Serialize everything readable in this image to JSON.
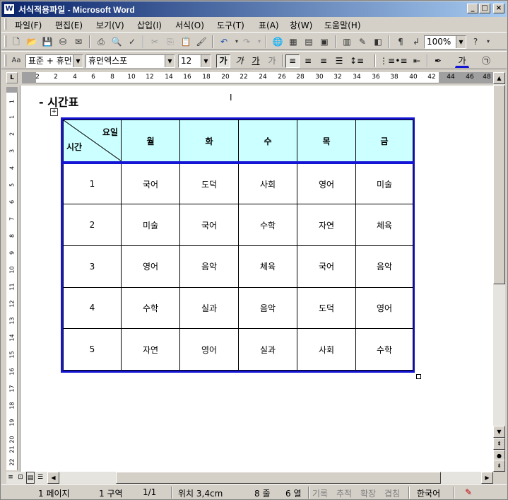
{
  "window": {
    "title": "서식적용파일 - Microsoft Word"
  },
  "menu": [
    "파일(F)",
    "편집(E)",
    "보기(V)",
    "삽입(I)",
    "서식(O)",
    "도구(T)",
    "표(A)",
    "창(W)",
    "도움말(H)"
  ],
  "toolbar": {
    "zoom": "100%"
  },
  "format": {
    "style": "표준 + 휴먼'",
    "font": "휴먼엑스포",
    "size": "12",
    "bold": "가",
    "italic": "가",
    "underline": "가",
    "shadow": "가",
    "fontcolor": "가"
  },
  "ruler": [
    "2",
    "2",
    "4",
    "6",
    "8",
    "10",
    "12",
    "14",
    "16",
    "18",
    "20",
    "22",
    "24",
    "26",
    "28",
    "30",
    "32",
    "34",
    "36",
    "38",
    "40",
    "42",
    "44",
    "46",
    "48"
  ],
  "vruler": [
    "1",
    "1",
    "2",
    "3",
    "4",
    "5",
    "6",
    "7",
    "8",
    "9",
    "10",
    "11",
    "12",
    "13",
    "14",
    "15",
    "16",
    "17",
    "18",
    "19",
    "20",
    "21",
    "22"
  ],
  "document": {
    "heading": "- 시간표",
    "table": {
      "corner_top": "요일",
      "corner_bottom": "시간",
      "days": [
        "월",
        "화",
        "수",
        "목",
        "금"
      ],
      "rows": [
        {
          "period": "1",
          "subjects": [
            "국어",
            "도덕",
            "사회",
            "영어",
            "미술"
          ]
        },
        {
          "period": "2",
          "subjects": [
            "미술",
            "국어",
            "수학",
            "자연",
            "체육"
          ]
        },
        {
          "period": "3",
          "subjects": [
            "영어",
            "음악",
            "체육",
            "국어",
            "음악"
          ]
        },
        {
          "period": "4",
          "subjects": [
            "수학",
            "실과",
            "음악",
            "도덕",
            "영어"
          ]
        },
        {
          "period": "5",
          "subjects": [
            "자연",
            "영어",
            "실과",
            "사회",
            "수학"
          ]
        }
      ]
    }
  },
  "status": {
    "page": "1 페이지",
    "section": "1 구역",
    "pages": "1/1",
    "position": "위치 3,4cm",
    "line": "8 줄",
    "column": "6 열",
    "rec": "기록",
    "trk": "추적",
    "ext": "확장",
    "ovr": "겹침",
    "lang": "한국어"
  },
  "colors": {
    "table_border": "#1414d4",
    "header_fill": "#ccffff",
    "titlebar": "#0a246a"
  }
}
